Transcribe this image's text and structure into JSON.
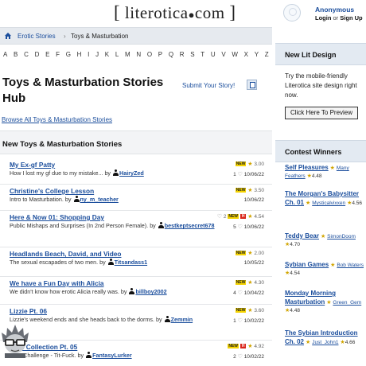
{
  "header": {
    "logo_open": "[",
    "logo_name": "literotica",
    "logo_dot": "●",
    "logo_tld": "com",
    "logo_close": "]"
  },
  "account": {
    "name": "Anonymous",
    "login": "Login",
    "or": "or",
    "signup": "Sign Up"
  },
  "breadcrumb": {
    "parent": "Erotic Stories",
    "separator": "›",
    "current": "Toys & Masturbation"
  },
  "alphabet": [
    "A",
    "B",
    "C",
    "D",
    "E",
    "F",
    "G",
    "H",
    "I",
    "J",
    "K",
    "L",
    "M",
    "N",
    "O",
    "P",
    "Q",
    "R",
    "S",
    "T",
    "U",
    "V",
    "W",
    "X",
    "Y",
    "Z"
  ],
  "hub": {
    "title": "Toys & Masturbation Stories Hub",
    "submit_label": "Submit Your Story!",
    "browse_label": "Browse All Toys & Masturbation Stories"
  },
  "list": {
    "heading": "New Toys & Masturbation Stories",
    "by": "by",
    "stories": [
      {
        "title": "My Ex-gf Patty",
        "desc": "How I lost my gf due to my mistake...",
        "author": "HairyZed",
        "new": "NEW",
        "hot": "",
        "favs": "",
        "rating": "3.00",
        "comments": "1",
        "date": "10/06/22"
      },
      {
        "title": "Christine's College Lesson",
        "desc": "Intro to Masturbation.",
        "author": "ny_m_teacher",
        "new": "NEW",
        "hot": "",
        "favs": "",
        "rating": "3.50",
        "comments": "",
        "date": "10/06/22"
      },
      {
        "title": "Here & Now 01: Shopping Day",
        "desc": "Public Mishaps and Surprises (In 2nd Person Female).",
        "author": "bestkeptsecret678",
        "new": "NEW",
        "hot": "H",
        "favs": "2",
        "rating": "4.54",
        "comments": "5",
        "date": "10/06/22"
      },
      {
        "title": "Headlands Beach, David, and Video",
        "desc": "The sexual escapades of two men.",
        "author": "Titsandass1",
        "new": "NEW",
        "hot": "",
        "favs": "",
        "rating": "2.00",
        "comments": "",
        "date": "10/05/22"
      },
      {
        "title": "We have a Fun Day with Alicia",
        "desc": "We didn't know how erotic Alicia really was.",
        "author": "billboy2002",
        "new": "NEW",
        "hot": "",
        "favs": "",
        "rating": "4.30",
        "comments": "4",
        "date": "10/04/22"
      },
      {
        "title": "Lizzie Pt. 06",
        "desc": "Lizzie's weekend ends and she heads back to the dorms.",
        "author": "Zemmin",
        "new": "NEW",
        "hot": "",
        "favs": "",
        "rating": "3.60",
        "comments": "1",
        "date": "10/02/22"
      },
      {
        "title": "Cum Collection Pt. 05",
        "desc": "Cum Challenge - Tit-Fuck.",
        "author": "FantasyLurker",
        "new": "NEW",
        "hot": "H",
        "favs": "",
        "rating": "4.92",
        "comments": "2",
        "date": "10/02/22"
      }
    ]
  },
  "sidebar": {
    "design_heading": "New Lit Design",
    "design_text": "Try the mobile-friendly Literotica site design right now.",
    "preview_button": "Click Here To Preview",
    "winners_heading": "Contest Winners",
    "winners": [
      {
        "title": "Self Pleasures",
        "author": "Many Feathers",
        "rating": "4.48"
      },
      {
        "title": "The Morgan's Babysitter Ch. 01",
        "author": "Mysticalvixxen",
        "rating": "4.56"
      },
      {
        "title": "Teddy Bear",
        "author": "SimonDoom",
        "rating": "4.70"
      },
      {
        "title": "Sybian Games",
        "author": "Bob Waters",
        "rating": "4.54"
      },
      {
        "title": "Monday Morning Masturbation",
        "author": "Green_Gem",
        "rating": "4.48"
      },
      {
        "title": "The Sybian Introduction Ch. 02",
        "author": "Just_John1",
        "rating": "4.66"
      }
    ]
  },
  "colors": {
    "link": "#1a4d9c",
    "panel": "#e3eaf2",
    "new_badge": "#f4d300",
    "hot_badge": "#d9261c"
  }
}
